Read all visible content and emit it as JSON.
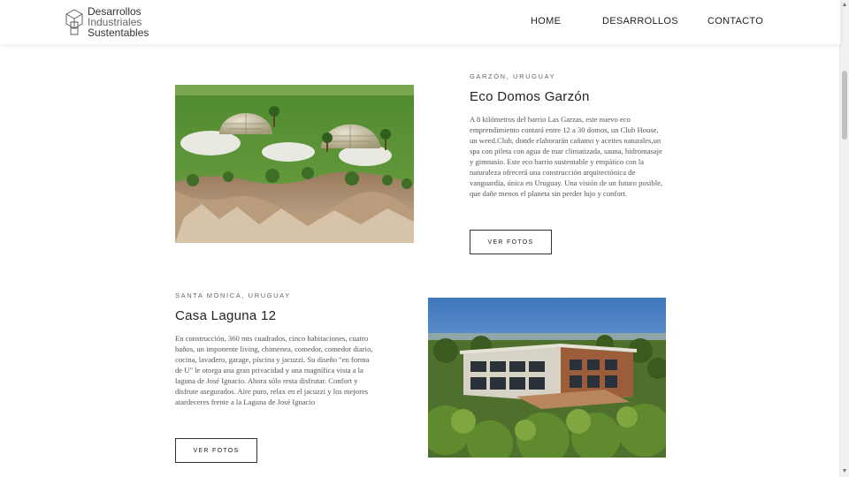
{
  "header": {
    "logo_lines": [
      "Desarrollos",
      "Industriales",
      "Sustentables"
    ],
    "nav": [
      "HOME",
      "DESARROLLOS",
      "CONTACTO"
    ]
  },
  "projects": [
    {
      "location": "GARZÓN, URUGUAY",
      "title": "Eco Domos Garzón",
      "description": "A 8 kilómetros del barrio Las Garzas, este nuevo eco emprendimiento contará entre 12 a 30 domos, un Club House, un weed.Club, donde elaborarán cañamo y aceites naturales,un spa con pileta con agua de mar climatizada, sauna, hidromasaje y gimnasio. Este eco barrio sustentable y empático con la naturaleza ofrecerá una construcción arquitectónica de vanguardia, única en Uruguay. Una visión de un futuro posible, que dañe menos el planeta sin perder lujo y confort.",
      "button": "VER FOTOS"
    },
    {
      "location": "SANTA MÓNICA, URUGUAY",
      "title": "Casa Laguna 12",
      "description": "En construcción, 360 mts cuadrados, cinco habitaciones, cuatro baños, un imponente living, chimenea, comedor, comedor diario, cocina, lavadero, garage, piscina y jacuzzi. Su diseño \"en forma de U\" le otorga una gran privacidad y una magnífica vista a la laguna de José Ignacio. Ahora sólo resta disfrutar. Confort y disfrute asegurados. Aire puro, relax en el jacuzzi y los mejores atardeceres frente a la Laguna de José Ignacio",
      "button": "VER FOTOS"
    }
  ],
  "colors": {
    "grass": "#5f8f3a",
    "sky": "#4b86c6",
    "text": "#222222"
  }
}
